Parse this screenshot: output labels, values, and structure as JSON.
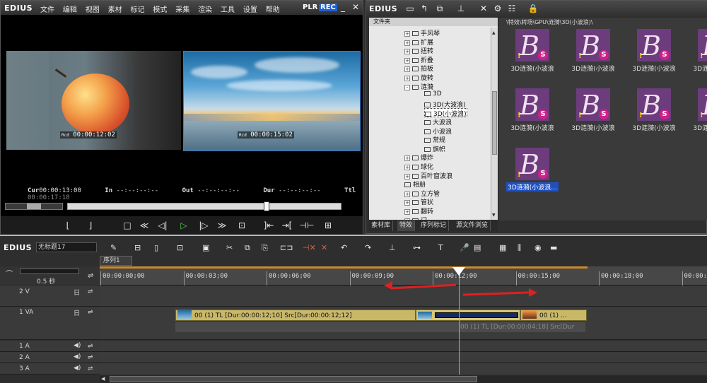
{
  "preview": {
    "logo": "EDIUS",
    "menu": [
      "文件",
      "编辑",
      "视图",
      "素材",
      "标记",
      "模式",
      "采集",
      "渲染",
      "工具",
      "设置",
      "帮助"
    ],
    "plr": "PLR",
    "rec": "REC",
    "player_tc": "00:00:12:02",
    "recorder_tc": "00:00:15:02",
    "tc_prefix": "Rcd",
    "cur_label": "Cur",
    "cur_value": "00:00:13:00",
    "in_label": "In",
    "in_value": "--:--:--:--",
    "out_label": "Out",
    "out_value": "--:--:--:--",
    "dur_label": "Dur",
    "dur_value": "--:--:--:--",
    "ttl_label": "Ttl",
    "ttl_value": "00:00:17:18"
  },
  "bin": {
    "logo": "EDIUS",
    "folder_header": "文件夹",
    "path": "\\特效\\转场\\GPU\\涟漪\\3D(小波浪)\\",
    "tree": [
      {
        "label": "手风琴",
        "level": 1,
        "expand": "+"
      },
      {
        "label": "扩展",
        "level": 1,
        "expand": "+"
      },
      {
        "label": "扭转",
        "level": 1,
        "expand": "+"
      },
      {
        "label": "折叠",
        "level": 1,
        "expand": "+"
      },
      {
        "label": "拍板",
        "level": 1,
        "expand": "+"
      },
      {
        "label": "旋转",
        "level": 1,
        "expand": "+"
      },
      {
        "label": "涟漪",
        "level": 1,
        "expand": "-"
      },
      {
        "label": "3D",
        "level": 2,
        "expand": ""
      },
      {
        "label": "3D(大波浪)",
        "level": 2,
        "expand": ""
      },
      {
        "label": "3D(小波浪)",
        "level": 2,
        "expand": "",
        "selected": true
      },
      {
        "label": "大波浪",
        "level": 2,
        "expand": ""
      },
      {
        "label": "小波浪",
        "level": 2,
        "expand": ""
      },
      {
        "label": "常规",
        "level": 2,
        "expand": ""
      },
      {
        "label": "旗帜",
        "level": 2,
        "expand": ""
      },
      {
        "label": "爆炸",
        "level": 1,
        "expand": "+"
      },
      {
        "label": "球化",
        "level": 1,
        "expand": "+"
      },
      {
        "label": "百叶窗波浪",
        "level": 1,
        "expand": "+"
      },
      {
        "label": "相册",
        "level": 1,
        "expand": ""
      },
      {
        "label": "立方管",
        "level": 1,
        "expand": "+"
      },
      {
        "label": "管状",
        "level": 1,
        "expand": "+"
      },
      {
        "label": "翻转",
        "level": 1,
        "expand": "+"
      },
      {
        "label": "门",
        "level": 1,
        "expand": "+"
      }
    ],
    "thumbs": [
      {
        "label": "3D涟漪(小波浪"
      },
      {
        "label": "3D涟漪(小波浪"
      },
      {
        "label": "3D涟漪(小波浪"
      },
      {
        "label": "3D涟漪(小波浪"
      },
      {
        "label": "3D涟漪(小波浪"
      },
      {
        "label": "3D涟漪(小波浪"
      },
      {
        "label": "3D涟漪(小波浪"
      },
      {
        "label": "3D涟漪(小波浪"
      },
      {
        "label": "3D涟漪(小波浪..."
      }
    ],
    "thumb_letter": "B",
    "thumb_badge": "S",
    "thumb_mark": "!",
    "tabs": [
      "素材库",
      "特效",
      "序列标记",
      "源文件浏览"
    ]
  },
  "timeline": {
    "logo": "EDIUS",
    "project": "无标题17",
    "sequence_tab": "序列1",
    "zoom": "0.5 秒",
    "ruler": [
      "00:00:00;00",
      "00:00:03;00",
      "00:00:06;00",
      "00:00:09;00",
      "00:00:12;00",
      "00:00:15;00",
      "00:00:18;00",
      "00:00:21"
    ],
    "tracks": [
      {
        "name": "2 V",
        "kind": "V"
      },
      {
        "name": "1 VA",
        "kind": "VA"
      },
      {
        "name": "1 A",
        "kind": "A"
      },
      {
        "name": "2 A",
        "kind": "A"
      },
      {
        "name": "3 A",
        "kind": "A"
      }
    ],
    "clip1": "00 (1)  TL [Dur:00:00:12;10]  Src[Dur:00:00:12;12]",
    "clip2": "00 (1)",
    "clip2_more": "...",
    "audio_clip": "00 (1)  TL [Dur:00:00:04;18]  Src[Dur",
    "track_nums": [
      "1",
      "2",
      "4",
      "5",
      "6",
      "7"
    ]
  },
  "colors": {
    "accent_blue": "#3a7bd0",
    "clip_yellow": "#c8b868",
    "arrow_red": "#e02020",
    "playhead": "#6ec6c6"
  }
}
